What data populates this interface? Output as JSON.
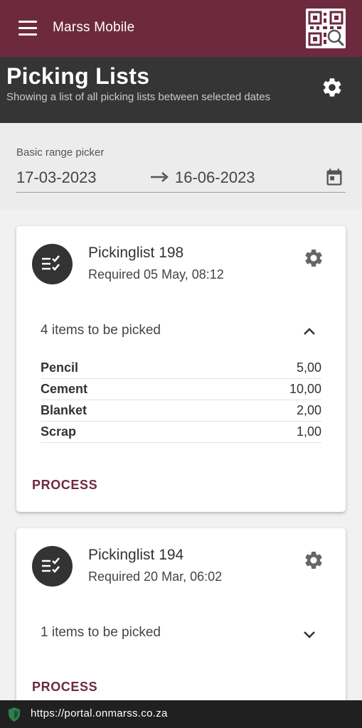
{
  "appbar": {
    "title": "Marss Mobile",
    "menu_icon": "hamburger-menu-icon",
    "qr_icon": "qr-code-search-icon"
  },
  "header": {
    "title": "Picking Lists",
    "subtitle": "Showing a list of all picking lists between selected dates",
    "settings_icon": "gear-icon"
  },
  "range": {
    "label": "Basic range picker",
    "start": "17-03-2023",
    "end": "16-06-2023",
    "calendar_icon": "calendar-icon"
  },
  "picking_lists": [
    {
      "title": "Pickinglist 198",
      "required": "Required 05 May, 08:12",
      "items_summary": "4 items to be picked",
      "expanded": true,
      "items": [
        {
          "name": "Pencil",
          "qty": "5,00"
        },
        {
          "name": "Cement",
          "qty": "10,00"
        },
        {
          "name": "Blanket",
          "qty": "2,00"
        },
        {
          "name": "Scrap",
          "qty": "1,00"
        }
      ],
      "action": "PROCESS"
    },
    {
      "title": "Pickinglist 194",
      "required": "Required 20 Mar, 06:02",
      "items_summary": "1 items to be picked",
      "expanded": false,
      "action": "PROCESS"
    }
  ],
  "browser": {
    "url": "https://portal.onmarss.co.za",
    "secure_icon": "shield-icon"
  },
  "colors": {
    "brand": "#6d2a3e",
    "header_bg": "#353535",
    "background": "#f1f1f1"
  }
}
